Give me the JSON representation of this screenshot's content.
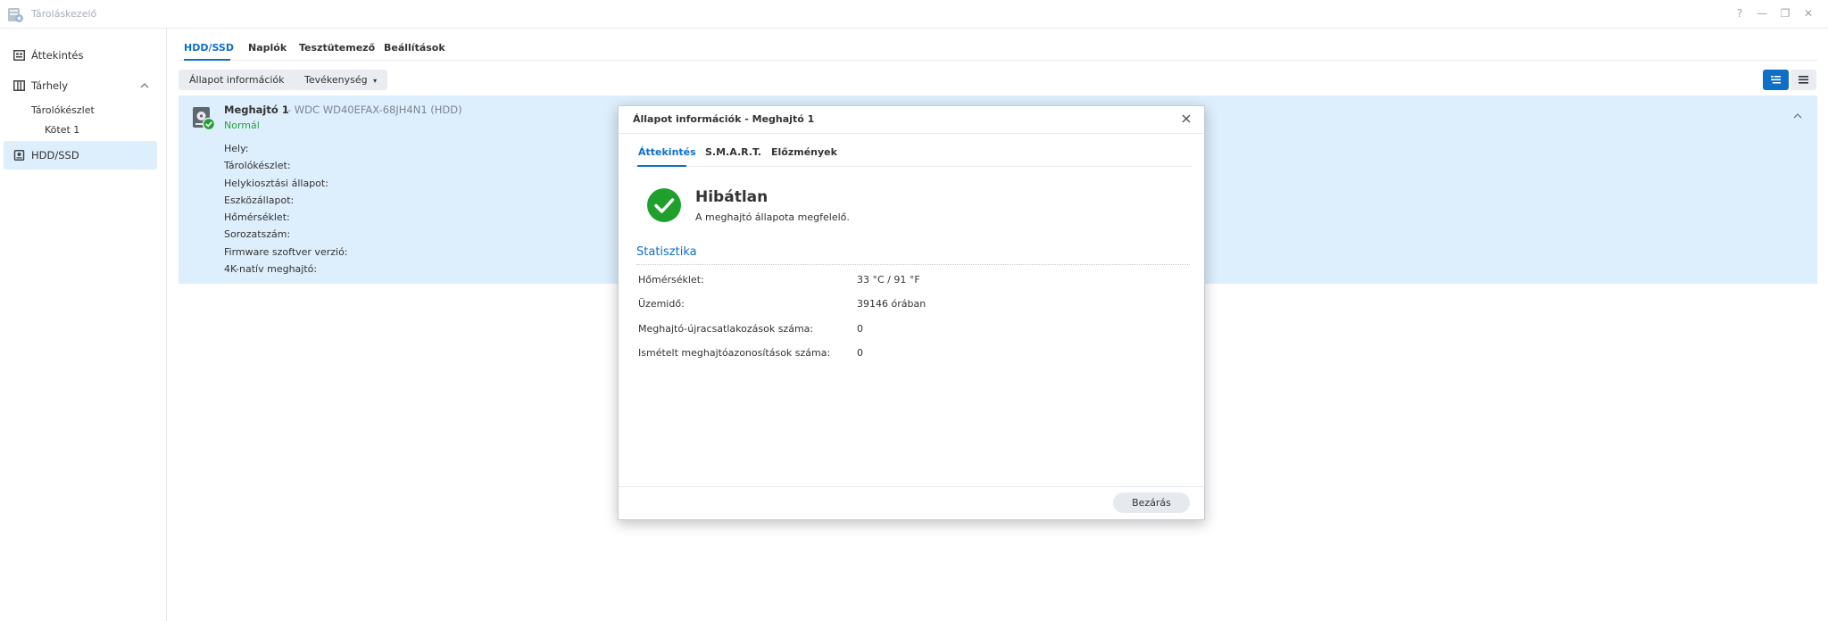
{
  "window": {
    "title": "Tároláskezelő",
    "controls": [
      "?",
      "—",
      "❐",
      "✕"
    ]
  },
  "sidebar": {
    "items": [
      {
        "label": "Áttekintés",
        "icon": "overview-icon"
      },
      {
        "label": "Tárhely",
        "icon": "storage-icon"
      },
      {
        "label": "Tárolókészlet"
      },
      {
        "label": "Kötet 1"
      },
      {
        "label": "HDD/SSD",
        "icon": "hdd-icon"
      }
    ]
  },
  "tabs": [
    "HDD/SSD",
    "Naplók",
    "Tesztütemező",
    "Beállítások"
  ],
  "toolbar": {
    "status_info": "Állapot információk",
    "actions": "Tevékenység",
    "actions_caret": "▾"
  },
  "drive": {
    "title": "Meghajtó 1",
    "model": "- WDC WD40EFAX-68JH4N1 (HDD)",
    "status": "Normál",
    "properties": [
      "Hely:",
      "Tárolókészlet:",
      "Helykiosztási állapot:",
      "Eszközállapot:",
      "Hőmérséklet:",
      "Sorozatszám:",
      "Firmware szoftver verzió:",
      "4K-natív meghajtó:"
    ]
  },
  "dialog": {
    "title": "Állapot információk - Meghajtó 1",
    "tabs": [
      "Áttekintés",
      "S.M.A.R.T.",
      "Előzmények"
    ],
    "health_title": "Hibátlan",
    "health_desc": "A meghajtó állapota megfelelő.",
    "section_title": "Statisztika",
    "stats": [
      {
        "label": "Hőmérséklet:",
        "value": "33 °C / 91 °F"
      },
      {
        "label": "Üzemidő:",
        "value": "39146 órában"
      },
      {
        "label": "Meghajtó-újracsatlakozások száma:",
        "value": "0"
      },
      {
        "label": "Ismételt meghajtóazonosítások száma:",
        "value": "0"
      }
    ],
    "close_label": "Bezárás"
  },
  "colors": {
    "accent": "#0f6fc6",
    "selected_row": "#ddeefc",
    "ok_green": "#1fa02d",
    "status_green": "#2ca33a"
  }
}
